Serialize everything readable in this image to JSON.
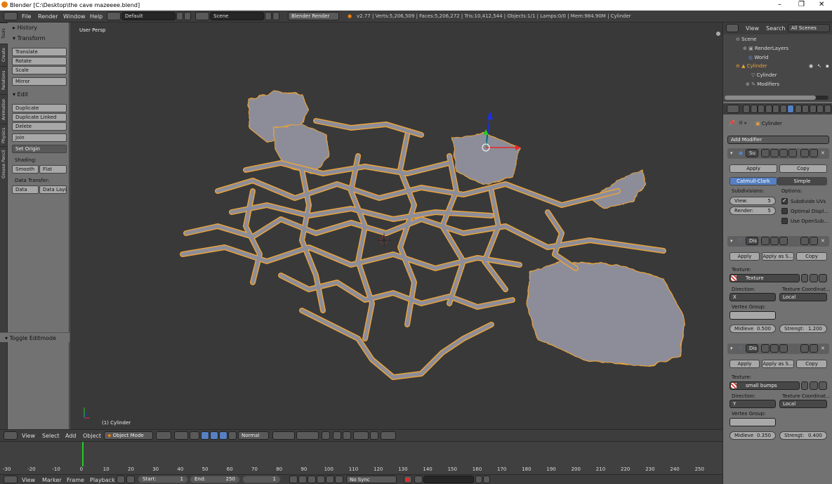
{
  "window": {
    "title": "Blender [C:\\Desktop\\the cave mazeeee.blend]",
    "minimize": "–",
    "maximize": "❐",
    "close": "✕"
  },
  "menubar": {
    "items": [
      "File",
      "Render",
      "Window",
      "Help"
    ],
    "layout": "Default",
    "scene": "Scene",
    "engine": "Blender Render",
    "stats": "v2.77 | Verts:5,206,509 | Faces:5,206,272 | Tris:10,412,544 | Objects:1/1 | Lamps:0/0 | Mem:984.90M | Cylinder"
  },
  "tabs": [
    "Tools",
    "Create",
    "Relations",
    "Animation",
    "Physics",
    "Grease Pencil"
  ],
  "toolshelf": {
    "history": "History",
    "transform": "Transform",
    "translate": "Translate",
    "rotate": "Rotate",
    "scale": "Scale",
    "mirror": "Mirror",
    "edit": "Edit",
    "duplicate": "Duplicate",
    "duplicate_linked": "Duplicate Linked",
    "delete": "Delete",
    "join": "Join",
    "set_origin": "Set Origin",
    "shading": "Shading:",
    "smooth": "Smooth",
    "flat": "Flat",
    "data_transfer": "Data Transfer:",
    "data": "Data",
    "data_layo": "Data Layo",
    "toggle_editmode": "Toggle Editmode"
  },
  "viewport": {
    "view_label": "User Persp",
    "object_label": "(1) Cylinder"
  },
  "viewheader": {
    "items": [
      "View",
      "Select",
      "Add",
      "Object"
    ],
    "mode": "Object Mode",
    "orientation": "Normal"
  },
  "timeline": {
    "ticks": [
      "-30",
      "-20",
      "-10",
      "0",
      "10",
      "20",
      "30",
      "40",
      "50",
      "60",
      "70",
      "80",
      "90",
      "100",
      "110",
      "120",
      "130",
      "140",
      "150",
      "160",
      "170",
      "180",
      "190",
      "200",
      "210",
      "220",
      "230",
      "240",
      "250"
    ],
    "current_frame": 0
  },
  "timeline_header": {
    "items": [
      "View",
      "Marker",
      "Frame",
      "Playback"
    ],
    "start": "Start:",
    "start_val": "1",
    "end": "End:",
    "end_val": "250",
    "current": "1",
    "sync": "No Sync"
  },
  "outliner": {
    "view": "View",
    "search": "Search",
    "filter": "All Scenes",
    "items": [
      "Scene",
      "RenderLayers",
      "World",
      "Cylinder",
      "Cylinder",
      "Modifiers"
    ]
  },
  "properties": {
    "object": "Cylinder",
    "add_modifier": "Add Modifier",
    "mod1": {
      "name": "Su",
      "apply": "Apply",
      "copy": "Copy",
      "catmull": "Catmull-Clark",
      "simple": "Simple",
      "subdivisions": "Subdivisions:",
      "options": "Options:",
      "view_label": "View:",
      "view_val": "5",
      "render_label": "Render:",
      "render_val": "5",
      "opt1": "Subdivide UVs",
      "opt2": "Optimal Displ...",
      "opt3": "Use OpenSub..."
    },
    "mod2": {
      "name": "Dis",
      "apply": "Apply",
      "apply_as": "Apply as S...",
      "copy": "Copy",
      "texture_label": "Texture:",
      "texture": "Texture",
      "direction": "Direction:",
      "tex_coord": "Texture Coordinat...",
      "dir_val": "X",
      "coord_val": "Local",
      "vertex_group": "Vertex Group:",
      "midlevel": "Midleve",
      "midlevel_val": "0.500",
      "strength": "Strengt:",
      "strength_val": "1.200"
    },
    "mod3": {
      "name": "Dis",
      "apply": "Apply",
      "apply_as": "Apply as S...",
      "copy": "Copy",
      "texture_label": "Texture:",
      "texture": "small bumps",
      "direction": "Direction:",
      "tex_coord": "Texture Coordinat...",
      "dir_val": "Y",
      "coord_val": "Local",
      "vertex_group": "Vertex Group:",
      "midlevel": "Midleve",
      "midlevel_val": "0.350",
      "strength": "Strengt:",
      "strength_val": "0.400"
    }
  },
  "colors": {
    "accent": "#5680c2",
    "selection": "#e8a33c",
    "viewport_bg": "#393939",
    "mesh": "#8d8d9a"
  }
}
